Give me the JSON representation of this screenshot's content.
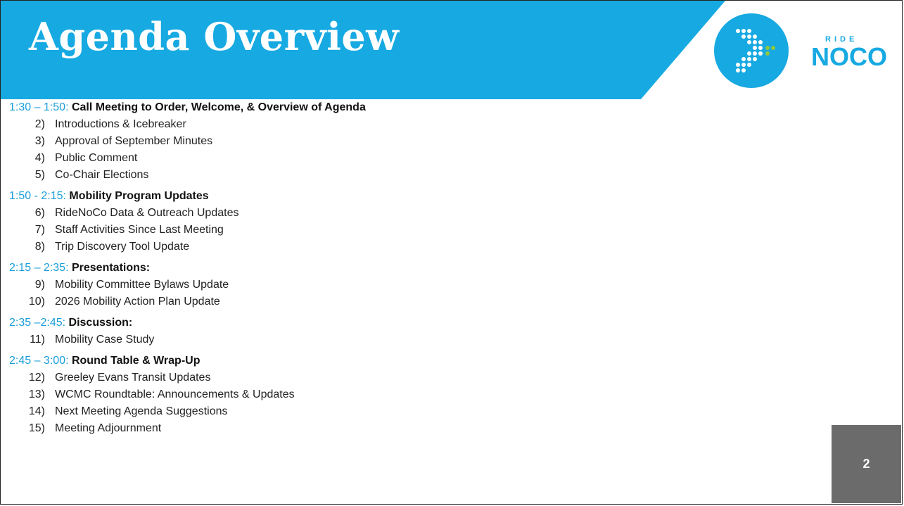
{
  "header": {
    "title": "Agenda Overview",
    "logo_text_small": "RIDE",
    "logo_text_large": "NOCO",
    "colors": {
      "banner": "#17a9e1",
      "white": "#ffffff",
      "logo_green": "#8dc63f"
    }
  },
  "agenda": {
    "sections": [
      {
        "time": "1:30 – 1:50:",
        "heading": "Call Meeting to Order, Welcome, & Overview of Agenda",
        "items": [
          {
            "num": "2)",
            "text": "Introductions & Icebreaker"
          },
          {
            "num": "3)",
            "text": "Approval of September Minutes"
          },
          {
            "num": "4)",
            "text": "Public Comment"
          },
          {
            "num": "5)",
            "text": "Co-Chair Elections"
          }
        ]
      },
      {
        "time": "1:50 - 2:15:",
        "heading": "Mobility Program Updates",
        "items": [
          {
            "num": "6)",
            "text": "RideNoCo Data & Outreach Updates"
          },
          {
            "num": "7)",
            "text": "Staff Activities Since Last Meeting"
          },
          {
            "num": "8)",
            "text": "Trip Discovery Tool Update"
          }
        ]
      },
      {
        "time": "2:15 – 2:35:",
        "heading": "Presentations:",
        "items": [
          {
            "num": "9)",
            "text": "Mobility Committee Bylaws Update"
          },
          {
            "num": "10)",
            "text": "2026 Mobility Action Plan Update"
          }
        ]
      },
      {
        "time": "2:35 –2:45:",
        "heading": "Discussion:",
        "items": [
          {
            "num": "11)",
            "text": "Mobility Case Study"
          }
        ]
      },
      {
        "time": "2:45 – 3:00:",
        "heading": "Round Table & Wrap-Up",
        "items": [
          {
            "num": "12)",
            "text": "Greeley Evans Transit Updates"
          },
          {
            "num": "13)",
            "text": "WCMC Roundtable: Announcements & Updates"
          },
          {
            "num": "14)",
            "text": "Next Meeting Agenda Suggestions"
          },
          {
            "num": "15)",
            "text": "Meeting Adjournment"
          }
        ]
      }
    ]
  },
  "footer": {
    "page_number": "2"
  }
}
